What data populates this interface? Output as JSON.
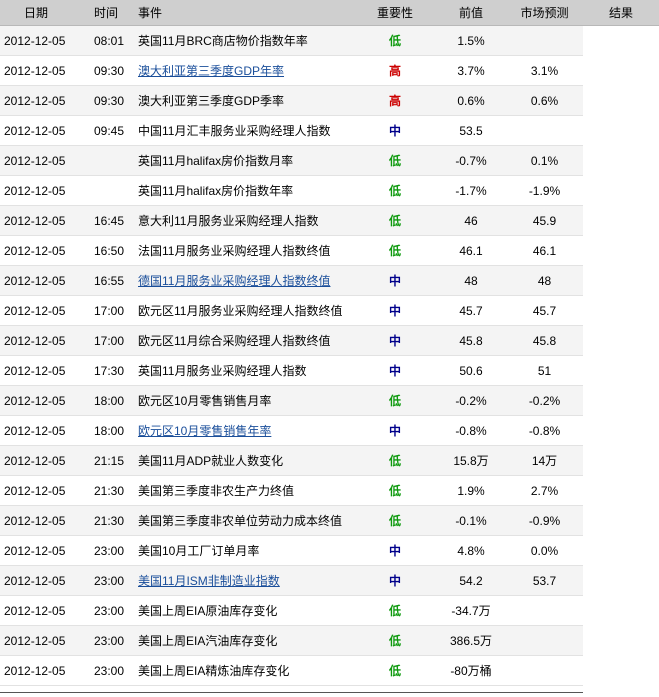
{
  "columns": {
    "date": "日期",
    "time": "时间",
    "event": "事件",
    "importance": "重要性",
    "previous": "前值",
    "forecast": "市场预测",
    "result": "结果"
  },
  "importance_colors": {
    "低": "#0e9a0e",
    "中": "#00008b",
    "高": "#cc0000"
  },
  "rows": [
    {
      "date": "2012-12-05",
      "time": "08:01",
      "event": "英国11月BRC商店物价指数年率",
      "link": false,
      "importance": "低",
      "previous": "1.5%",
      "forecast": ""
    },
    {
      "date": "2012-12-05",
      "time": "09:30",
      "event": "澳大利亚第三季度GDP年率",
      "link": true,
      "importance": "高",
      "previous": "3.7%",
      "forecast": "3.1%"
    },
    {
      "date": "2012-12-05",
      "time": "09:30",
      "event": "澳大利亚第三季度GDP季率",
      "link": false,
      "importance": "高",
      "previous": "0.6%",
      "forecast": "0.6%"
    },
    {
      "date": "2012-12-05",
      "time": "09:45",
      "event": "中国11月汇丰服务业采购经理人指数",
      "link": false,
      "importance": "中",
      "previous": "53.5",
      "forecast": ""
    },
    {
      "date": "2012-12-05",
      "time": "",
      "event": "英国11月halifax房价指数月率",
      "link": false,
      "importance": "低",
      "previous": "-0.7%",
      "forecast": "0.1%"
    },
    {
      "date": "2012-12-05",
      "time": "",
      "event": "英国11月halifax房价指数年率",
      "link": false,
      "importance": "低",
      "previous": "-1.7%",
      "forecast": "-1.9%"
    },
    {
      "date": "2012-12-05",
      "time": "16:45",
      "event": "意大利11月服务业采购经理人指数",
      "link": false,
      "importance": "低",
      "previous": "46",
      "forecast": "45.9"
    },
    {
      "date": "2012-12-05",
      "time": "16:50",
      "event": "法国11月服务业采购经理人指数终值",
      "link": false,
      "importance": "低",
      "previous": "46.1",
      "forecast": "46.1"
    },
    {
      "date": "2012-12-05",
      "time": "16:55",
      "event": "德国11月服务业采购经理人指数终值",
      "link": true,
      "importance": "中",
      "previous": "48",
      "forecast": "48"
    },
    {
      "date": "2012-12-05",
      "time": "17:00",
      "event": "欧元区11月服务业采购经理人指数终值",
      "link": false,
      "importance": "中",
      "previous": "45.7",
      "forecast": "45.7"
    },
    {
      "date": "2012-12-05",
      "time": "17:00",
      "event": "欧元区11月综合采购经理人指数终值",
      "link": false,
      "importance": "中",
      "previous": "45.8",
      "forecast": "45.8"
    },
    {
      "date": "2012-12-05",
      "time": "17:30",
      "event": "英国11月服务业采购经理人指数",
      "link": false,
      "importance": "中",
      "previous": "50.6",
      "forecast": "51"
    },
    {
      "date": "2012-12-05",
      "time": "18:00",
      "event": "欧元区10月零售销售月率",
      "link": false,
      "importance": "低",
      "previous": "-0.2%",
      "forecast": "-0.2%"
    },
    {
      "date": "2012-12-05",
      "time": "18:00",
      "event": "欧元区10月零售销售年率",
      "link": true,
      "importance": "中",
      "previous": "-0.8%",
      "forecast": "-0.8%"
    },
    {
      "date": "2012-12-05",
      "time": "21:15",
      "event": "美国11月ADP就业人数变化",
      "link": false,
      "importance": "低",
      "previous": "15.8万",
      "forecast": "14万"
    },
    {
      "date": "2012-12-05",
      "time": "21:30",
      "event": "美国第三季度非农生产力终值",
      "link": false,
      "importance": "低",
      "previous": "1.9%",
      "forecast": "2.7%"
    },
    {
      "date": "2012-12-05",
      "time": "21:30",
      "event": "美国第三季度非农单位劳动力成本终值",
      "link": false,
      "importance": "低",
      "previous": "-0.1%",
      "forecast": "-0.9%"
    },
    {
      "date": "2012-12-05",
      "time": "23:00",
      "event": "美国10月工厂订单月率",
      "link": false,
      "importance": "中",
      "previous": "4.8%",
      "forecast": "0.0%"
    },
    {
      "date": "2012-12-05",
      "time": "23:00",
      "event": "美国11月ISM非制造业指数",
      "link": true,
      "importance": "中",
      "previous": "54.2",
      "forecast": "53.7"
    },
    {
      "date": "2012-12-05",
      "time": "23:00",
      "event": "美国上周EIA原油库存变化",
      "link": false,
      "importance": "低",
      "previous": "-34.7万",
      "forecast": ""
    },
    {
      "date": "2012-12-05",
      "time": "23:00",
      "event": "美国上周EIA汽油库存变化",
      "link": false,
      "importance": "低",
      "previous": "386.5万",
      "forecast": ""
    },
    {
      "date": "2012-12-05",
      "time": "23:00",
      "event": "美国上周EIA精炼油库存变化",
      "link": false,
      "importance": "低",
      "previous": "-80万桶",
      "forecast": ""
    }
  ]
}
